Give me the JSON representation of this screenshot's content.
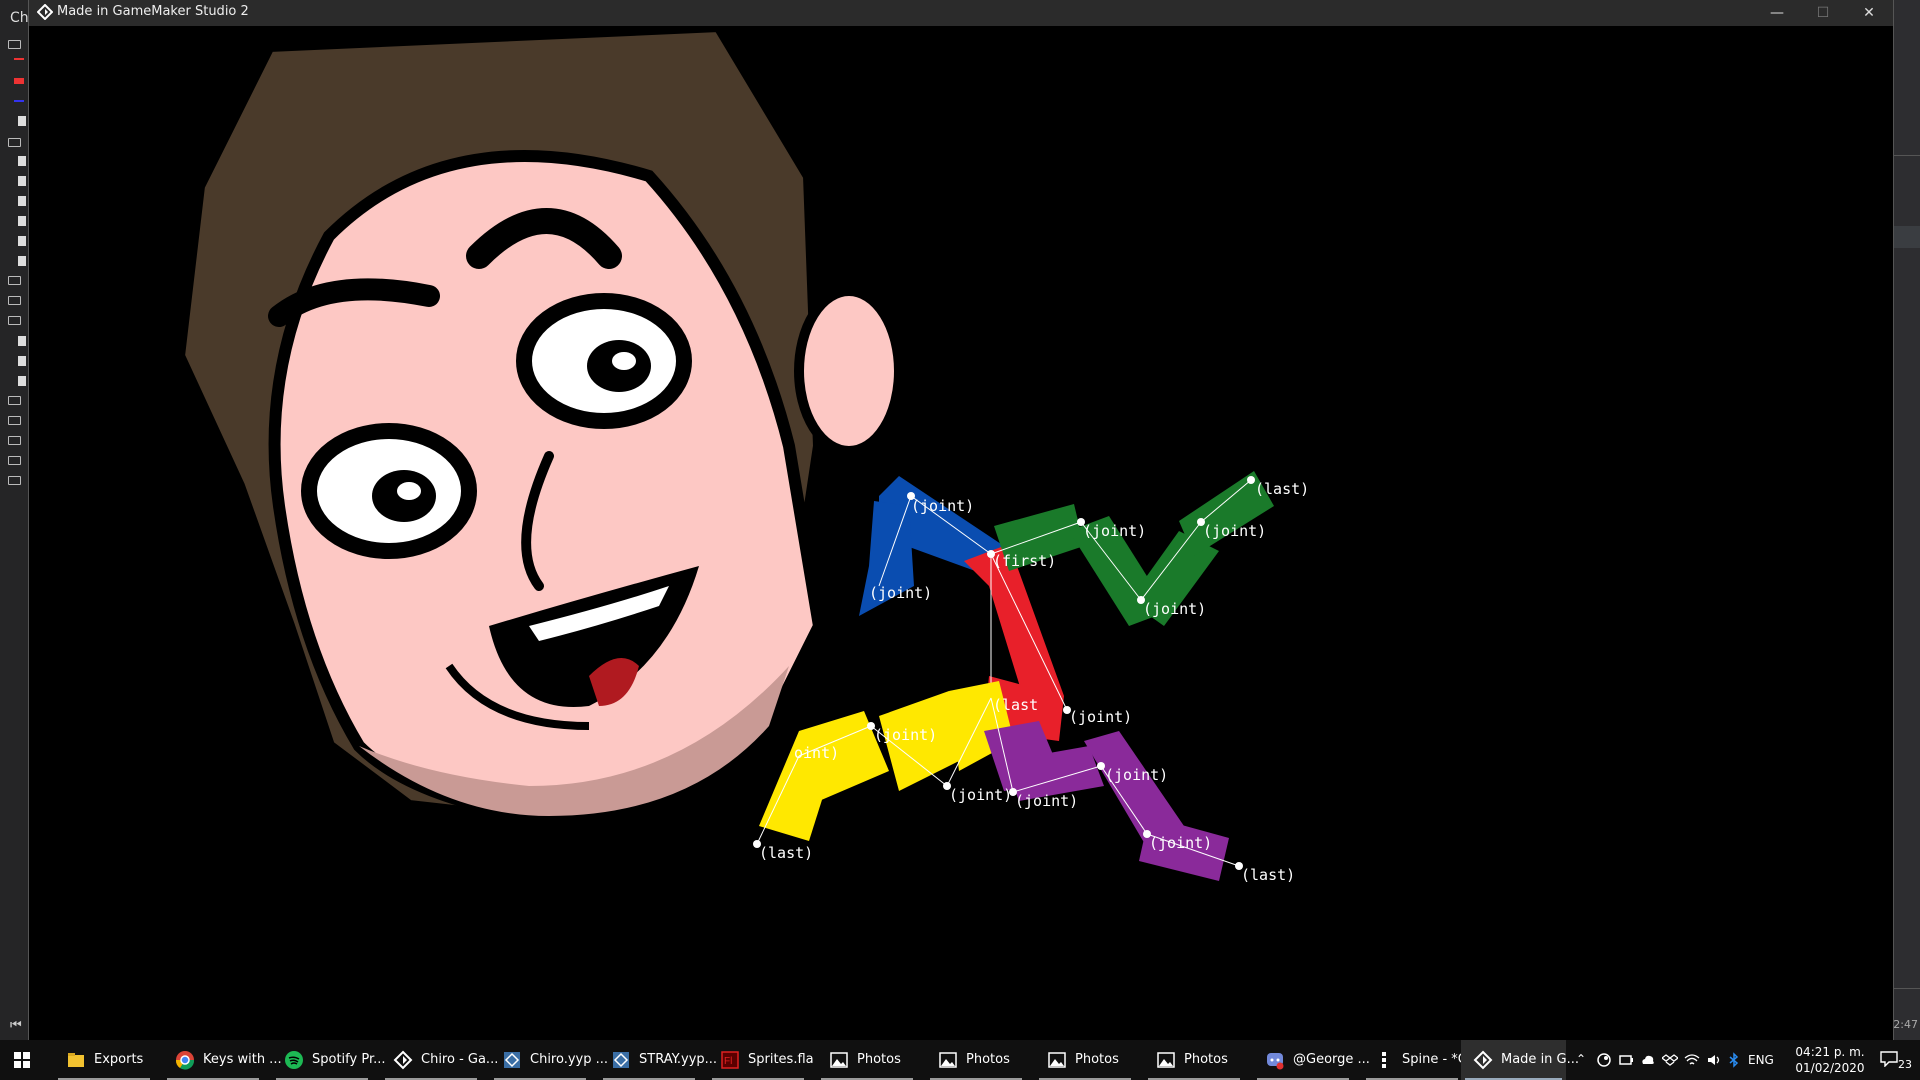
{
  "window": {
    "title": "Made in GameMaker Studio 2",
    "minimize": "—",
    "maximize": "☐",
    "close": "✕"
  },
  "left_panel": {
    "header": "Ch",
    "bottom_icon": "⏮"
  },
  "right_panel": {
    "timestamp": "2:47"
  },
  "labels": {
    "blue_joint_top": "(joint)",
    "blue_joint_bottom": "(joint)",
    "red_first": "(first)",
    "red_last": "(last",
    "red_joint": "(joint)",
    "green_joint_1": "(joint)",
    "green_joint_2": "(joint)",
    "green_joint_3": "(joint)",
    "green_last": "(last)",
    "yellow_joint_1": "(joint)",
    "yellow_joint_2": "oint)",
    "yellow_joint_3": "(joint)",
    "yellow_last": "(last)",
    "purple_joint_1": "(joint)",
    "purple_joint_2": "(joint)",
    "purple_joint_3": "(joint)",
    "purple_last": "(last)"
  },
  "colors": {
    "blue": "#0a4db0",
    "red": "#e8202a",
    "green": "#1a7a2a",
    "yellow": "#ffe800",
    "purple": "#8a2a9a",
    "skin": "#fdc8c4",
    "hair": "#4a3a2a"
  },
  "taskbar": {
    "items": [
      {
        "label": "Exports",
        "icon": "folder-icon"
      },
      {
        "label": "Keys with ...",
        "icon": "chrome-icon"
      },
      {
        "label": "Spotify Pr...",
        "icon": "spotify-icon"
      },
      {
        "label": "Chiro - Ga...",
        "icon": "gamemaker-icon"
      },
      {
        "label": "Chiro.yyp ...",
        "icon": "gamemaker-project-icon"
      },
      {
        "label": "STRAY.yyp...",
        "icon": "gamemaker-project-icon"
      },
      {
        "label": "Sprites.fla",
        "icon": "flash-icon"
      },
      {
        "label": "Photos",
        "icon": "photos-icon"
      },
      {
        "label": "Photos",
        "icon": "photos-icon"
      },
      {
        "label": "Photos",
        "icon": "photos-icon"
      },
      {
        "label": "Photos",
        "icon": "photos-icon"
      },
      {
        "label": "@George ...",
        "icon": "discord-icon"
      },
      {
        "label": "Spine - *C...",
        "icon": "spine-icon"
      },
      {
        "label": "Made in G...",
        "icon": "gamemaker-icon"
      }
    ],
    "tray": {
      "language": "ENG",
      "time": "04:21 p. m.",
      "date": "01/02/2020",
      "notifications": "23"
    }
  }
}
